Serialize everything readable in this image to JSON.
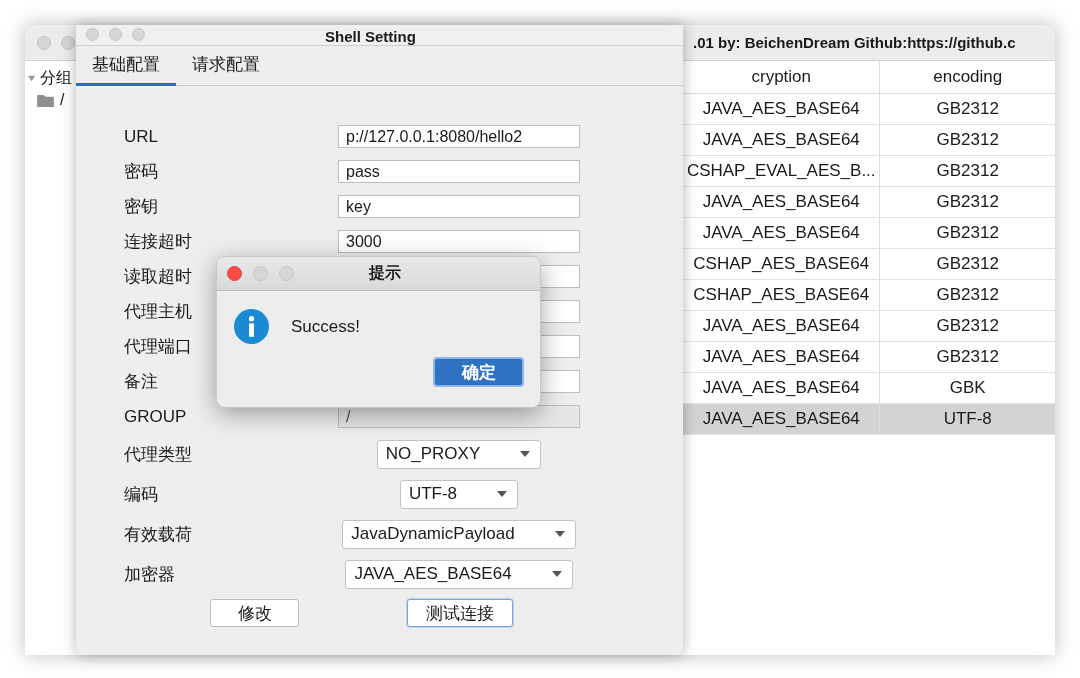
{
  "main_window": {
    "title": ".01 by: BeichenDream Github:https://github.c",
    "tree": [
      {
        "label": "分组",
        "expanded": true,
        "children": [
          {
            "label": "/"
          }
        ]
      }
    ],
    "table": {
      "columns": [
        "cryption",
        "encoding"
      ],
      "rows": [
        {
          "cells": [
            "JAVA_AES_BASE64",
            "GB2312"
          ],
          "selected": false
        },
        {
          "cells": [
            "JAVA_AES_BASE64",
            "GB2312"
          ],
          "selected": false
        },
        {
          "cells": [
            "CSHAP_EVAL_AES_B...",
            "GB2312"
          ],
          "selected": false
        },
        {
          "cells": [
            "JAVA_AES_BASE64",
            "GB2312"
          ],
          "selected": false
        },
        {
          "cells": [
            "JAVA_AES_BASE64",
            "GB2312"
          ],
          "selected": false
        },
        {
          "cells": [
            "CSHAP_AES_BASE64",
            "GB2312"
          ],
          "selected": false
        },
        {
          "cells": [
            "CSHAP_AES_BASE64",
            "GB2312"
          ],
          "selected": false
        },
        {
          "cells": [
            "JAVA_AES_BASE64",
            "GB2312"
          ],
          "selected": false
        },
        {
          "cells": [
            "JAVA_AES_BASE64",
            "GB2312"
          ],
          "selected": false
        },
        {
          "cells": [
            "JAVA_AES_BASE64",
            "GBK"
          ],
          "selected": false
        },
        {
          "cells": [
            "JAVA_AES_BASE64",
            "UTF-8"
          ],
          "selected": true
        }
      ]
    }
  },
  "shell_setting": {
    "title": "Shell Setting",
    "tabs": [
      {
        "label": "基础配置",
        "selected": true
      },
      {
        "label": "请求配置",
        "selected": false
      }
    ],
    "fields": [
      {
        "label": "URL",
        "kind": "text",
        "value": "p://127.0.0.1:8080/hello2",
        "disabled": false
      },
      {
        "label": "密码",
        "kind": "text",
        "value": "pass",
        "disabled": false
      },
      {
        "label": "密钥",
        "kind": "text",
        "value": "key",
        "disabled": false
      },
      {
        "label": "连接超时",
        "kind": "text",
        "value": "3000",
        "disabled": false
      },
      {
        "label": "读取超时",
        "kind": "text",
        "disabled": false
      },
      {
        "label": "代理主机",
        "kind": "text",
        "disabled": false
      },
      {
        "label": "代理端口",
        "kind": "text",
        "disabled": false
      },
      {
        "label": "备注",
        "kind": "text",
        "disabled": false
      },
      {
        "label": "GROUP",
        "kind": "text",
        "value": "/",
        "disabled": true
      },
      {
        "label": "代理类型",
        "kind": "select",
        "value": "NO_PROXY",
        "disabled": false
      },
      {
        "label": "编码",
        "kind": "select",
        "value": "UTF-8",
        "disabled": false
      },
      {
        "label": "有效载荷",
        "kind": "select",
        "value": "JavaDynamicPayload",
        "disabled": false
      },
      {
        "label": "加密器",
        "kind": "select",
        "value": "JAVA_AES_BASE64",
        "disabled": false
      }
    ],
    "buttons": [
      {
        "label": "修改",
        "focused": false
      },
      {
        "label": "测试连接",
        "focused": true
      }
    ]
  },
  "alert": {
    "title": "提示",
    "message": "Success!",
    "button": "确定"
  }
}
